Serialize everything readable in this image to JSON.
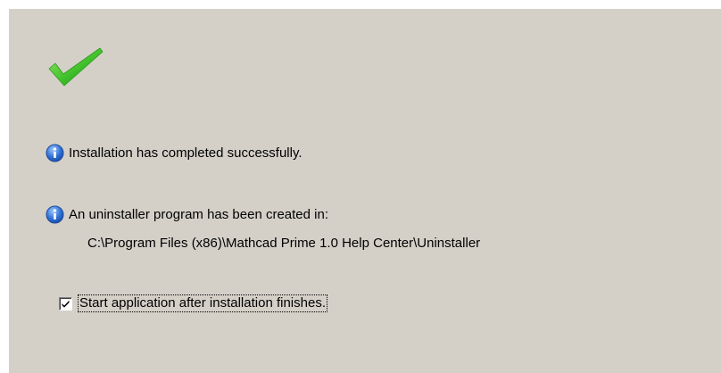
{
  "messages": [
    {
      "icon": "info-icon",
      "text": "Installation has completed successfully."
    },
    {
      "icon": "info-icon",
      "text": "An uninstaller program has been created in:"
    }
  ],
  "uninstaller_path": "C:\\Program Files (x86)\\Mathcad Prime 1.0 Help Center\\Uninstaller",
  "start_app_checkbox": {
    "label": "Start application after installation finishes.",
    "checked": true
  },
  "success_icon": "checkmark-icon",
  "colors": {
    "panel_background": "#d4d0c8",
    "check_green": "#3fbf2a",
    "info_blue": "#2f6fd1"
  }
}
